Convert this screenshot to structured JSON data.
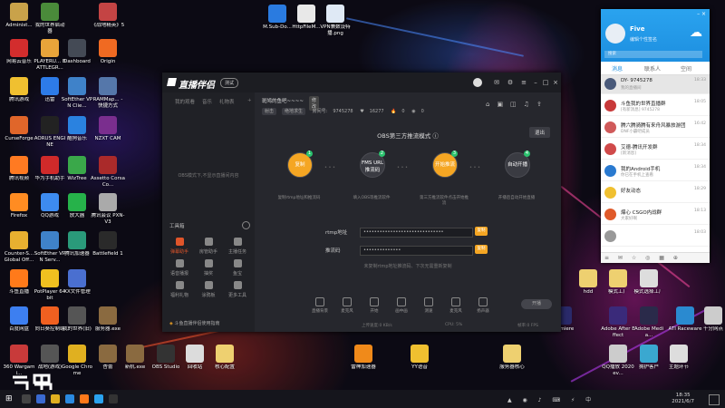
{
  "desktop_icons": [
    {
      "label": "Administ...",
      "color": "#c9a24a"
    },
    {
      "label": "我的世界启动器",
      "color": "#4a8a3a"
    },
    {
      "label": "《战地精英》5",
      "color": "#c44444"
    },
    {
      "label": "M.Sub-Do...",
      "color": "#2a7be0"
    },
    {
      "label": "HttpFileM...",
      "color": "#e8e8e8"
    },
    {
      "label": "VPN兼数设特播.png",
      "color": "#dfe9f5"
    },
    {
      "label": "网易云音乐",
      "color": "#d32d2d"
    },
    {
      "label": "PLAYERU... BATTLEGR...",
      "color": "#e8a43a"
    },
    {
      "label": "Dashboard",
      "color": "#444a55"
    },
    {
      "label": "Origin",
      "color": "#f06a22"
    },
    {
      "label": "腾讯游戏",
      "color": "#f0c030"
    },
    {
      "label": "迅雷",
      "color": "#2d7be8"
    },
    {
      "label": "SoftEther VPN Clie...",
      "color": "#3f82c9"
    },
    {
      "label": "RAMMap... - 快捷方式",
      "color": "#5577aa"
    },
    {
      "label": "CurseForge",
      "color": "#e0662a"
    },
    {
      "label": "AORUS ENGINE",
      "color": "#222"
    },
    {
      "label": "酷狗音乐",
      "color": "#2a82e0"
    },
    {
      "label": "NZXT CAM",
      "color": "#7a2e8e"
    },
    {
      "label": "腾讯视频",
      "color": "#ff7a22"
    },
    {
      "label": "华为手机助手",
      "color": "#d02a2a"
    },
    {
      "label": "WizTree",
      "color": "#3aa84a"
    },
    {
      "label": "Assetto Corsa Co...",
      "color": "#aa2a2a"
    },
    {
      "label": "Firefox",
      "color": "#ff8c22"
    },
    {
      "label": "QQ游戏",
      "color": "#3d8bf0"
    },
    {
      "label": "放大器",
      "color": "#26b24a"
    },
    {
      "label": "腾讯会议 PXN-V3",
      "color": "#aaa"
    },
    {
      "label": "Counter-S... Global Off...",
      "color": "#e8b030"
    },
    {
      "label": "SoftEther VPN Serv...",
      "color": "#3f82c9"
    },
    {
      "label": "腾讯加速器",
      "color": "#2a9a7a"
    },
    {
      "label": "Battlefield 1",
      "color": "#2a2a2a"
    },
    {
      "label": "斗鱼直播",
      "color": "#ff7a1a"
    },
    {
      "label": "PotPlayer 64 bit",
      "color": "#f0c020"
    },
    {
      "label": "XX文件管理",
      "color": "#4a6fd0"
    },
    {
      "label": "百度网盘",
      "color": "#3d7ff0"
    },
    {
      "label": "向日葵控制端",
      "color": "#f06020"
    },
    {
      "label": "我的世界(旧)",
      "color": "#555"
    },
    {
      "label": "服务器.exe",
      "color": "#8a6a40"
    },
    {
      "label": "360 Wargami...",
      "color": "#c83a3a"
    },
    {
      "label": "战地(游戏)",
      "color": "#555"
    },
    {
      "label": "Google Chrome",
      "color": "#e0b020"
    },
    {
      "label": "杏蕾",
      "color": "#8a6a40"
    },
    {
      "label": "新机.exe",
      "color": "#8a6a40"
    },
    {
      "label": "OBS Studio",
      "color": "#333"
    },
    {
      "label": "回收站",
      "color": "#dcdcdc"
    },
    {
      "label": "核心配置",
      "color": "#eed070"
    },
    {
      "label": "雷神加速器",
      "color": "#f08a1a"
    },
    {
      "label": "YY语音",
      "color": "#f0c030"
    },
    {
      "label": "服务器核心",
      "color": "#eed070"
    },
    {
      "label": "hdd",
      "color": "#eed070"
    },
    {
      "label": "模式工厂",
      "color": "#eed070"
    },
    {
      "label": "模式选择工厂",
      "color": "#ddd"
    },
    {
      "label": "Premiere",
      "color": "#2a2a6a"
    },
    {
      "label": "Adobe After Effect",
      "color": "#3a2a7a"
    },
    {
      "label": "Adobe Media...",
      "color": "#2a2a4a"
    },
    {
      "label": "ATI Raceware",
      "color": "#2a8ad0"
    },
    {
      "label": "千分网点",
      "color": "#ccc"
    },
    {
      "label": "QQ播放 2020 ev...",
      "color": "#ccc"
    },
    {
      "label": "拥护客户",
      "color": "#3aa8d0"
    },
    {
      "label": "主题环节",
      "color": "#ddd"
    }
  ],
  "app": {
    "name": "直播伴侣",
    "beta": "测试",
    "side_tabs": [
      "我的观看",
      "音乐",
      "礼物表"
    ],
    "side_msg": "OBS模式下,不显示直播间内容",
    "tools_title": "工具箱",
    "tools": [
      {
        "label": "弹幕助手"
      },
      {
        "label": "房管助手"
      },
      {
        "label": "主播任务"
      },
      {
        "label": "语音播报"
      },
      {
        "label": "抽奖"
      },
      {
        "label": "鱼宝"
      },
      {
        "label": "福利礼物"
      },
      {
        "label": "涂鸦板"
      },
      {
        "label": "更多工具"
      }
    ],
    "room": {
      "name": "斑鸠的鱼吧~~~~",
      "edit": "修改",
      "tags": [
        "射击",
        "绝地求生"
      ],
      "id_label": "房间号:",
      "id": "9745278",
      "fans_label": "粉丝",
      "fans": "16277",
      "hot": "0",
      "num": "0"
    },
    "obs": {
      "title": "OBS第三方推流模式",
      "exit": "退出",
      "steps": [
        {
          "num": "1",
          "label": "复制",
          "desc": "复制rtmp地址和推流码"
        },
        {
          "num": "2",
          "label": "FMS URL 推流码",
          "desc": "填入OBS等推流软件"
        },
        {
          "num": "3",
          "label": "开始推流",
          "desc": "第三方推流软件点击开始推流"
        },
        {
          "num": "4",
          "label": "自动开播",
          "desc": "开播后自动开始直播"
        }
      ],
      "rtmp_label": "rtmp地址",
      "rtmp_value": "••••••••••••••••••••••••••••••",
      "key_label": "推流码",
      "key_value": "••••••••••••••",
      "copy": "复制",
      "note": "未复制rtmp地址推流码、下次无需重新复制"
    },
    "bottom_tools": [
      {
        "label": "直播背景"
      },
      {
        "label": "麦克风"
      },
      {
        "label": "开始"
      },
      {
        "label": "画中画"
      },
      {
        "label": "测速"
      },
      {
        "label": "麦克风"
      },
      {
        "label": "扬声器"
      }
    ],
    "start_btn": "开播",
    "status": {
      "left": "上传速度:0 KB/s",
      "mid": "CPU: 5%",
      "right": "帧率:0 FPS"
    },
    "notice": "斗鱼直播伴侣使用指南"
  },
  "chat": {
    "name": "Five",
    "signature": "编辑个性签名",
    "search": "搜索",
    "tabs": [
      {
        "label": "消息",
        "active": true
      },
      {
        "label": "联系人",
        "active": false
      },
      {
        "label": "空间",
        "active": false
      }
    ],
    "items": [
      {
        "title": "DY- 9745278",
        "sub": "我的直播间",
        "time": "18:33",
        "color": "#4a5a7a",
        "sel": true
      },
      {
        "title": "斗鱼我的世界直播群",
        "sub": "[有新消息] 9745278",
        "time": "18:05",
        "color": "#c83a3a",
        "sel": false
      },
      {
        "title": "腾六腾骑腾有来舟风暴旅游团",
        "sub": "DNF小霸吧成员",
        "time": "16:42",
        "color": "#d05a5a",
        "sel": false
      },
      {
        "title": "艾德-腾讯开发群",
        "sub": "[新消息]",
        "time": "18:34",
        "color": "#d04a4a",
        "sel": false
      },
      {
        "title": "我的Android手机",
        "sub": "你已在手机上查看",
        "time": "18:34",
        "color": "#2a7ad0",
        "sel": false
      },
      {
        "title": "好友动态",
        "sub": "",
        "time": "18:29",
        "color": "#f0c030",
        "sel": false
      },
      {
        "title": "爆心 CSGO内战群",
        "sub": "大家好啊",
        "time": "18:13",
        "color": "#e05a2a",
        "sel": false
      },
      {
        "title": "",
        "sub": "",
        "time": "18:03",
        "color": "#999",
        "sel": false
      }
    ]
  },
  "taskbar": {
    "time": "18:35",
    "date": "2021/6/7"
  },
  "watermark": "斗鱼"
}
